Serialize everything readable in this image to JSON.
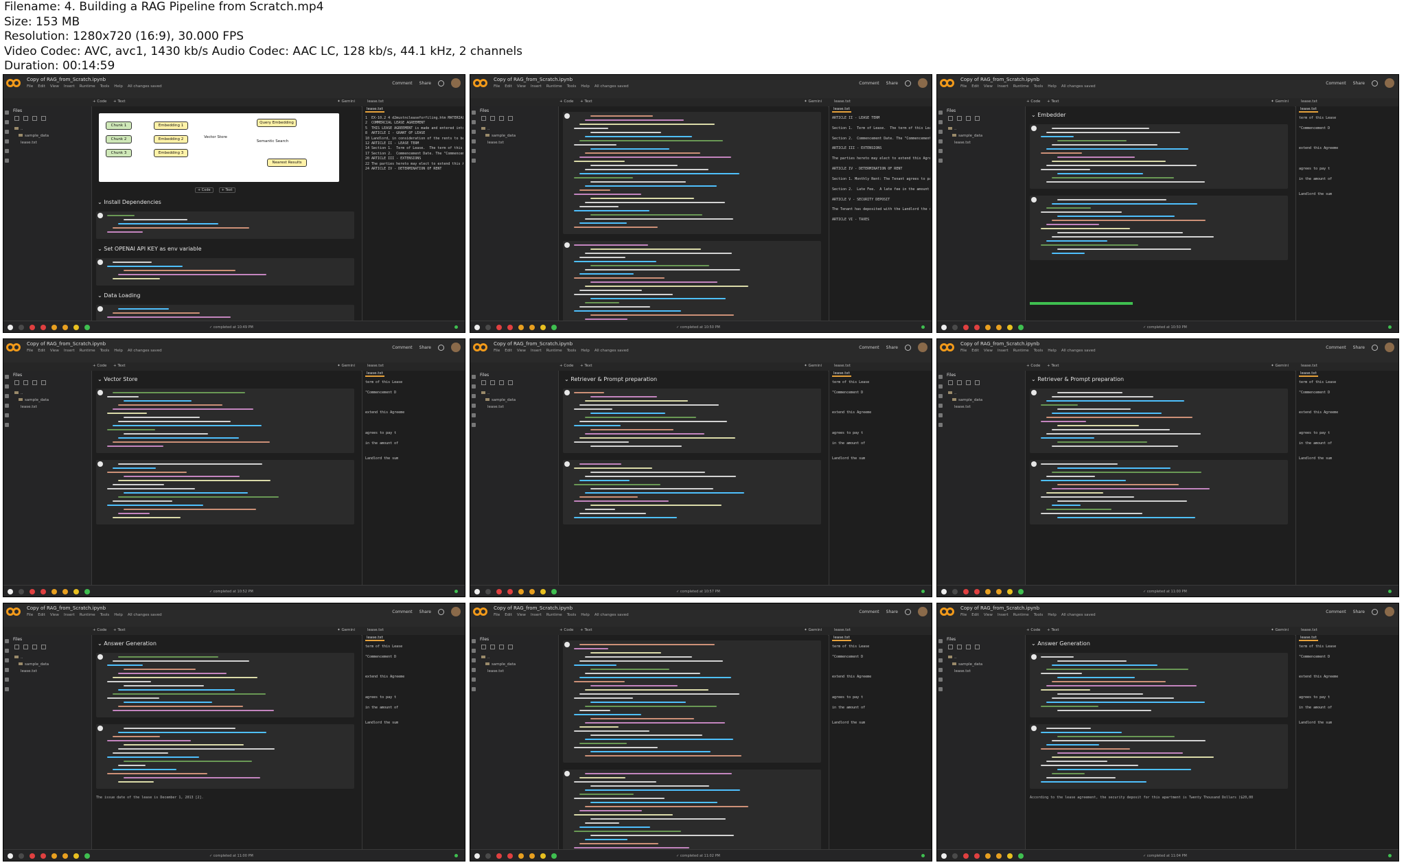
{
  "header": {
    "filename": "Filename: 4. Building a RAG Pipeline from Scratch.mp4",
    "size": "Size: 153 MB",
    "resolution": "Resolution: 1280x720 (16:9), 30.000 FPS",
    "codec": "Video Codec: AVC, avc1, 1430 kb/s Audio Codec: AAC LC, 128 kb/s, 44.1 kHz, 2 channels",
    "duration": "Duration: 00:14:59"
  },
  "colab": {
    "notebook_title": "Copy of RAG_from_Scratch.ipynb",
    "menu": [
      "File",
      "Edit",
      "View",
      "Insert",
      "Runtime",
      "Tools",
      "Help",
      "All changes saved"
    ],
    "top_right": [
      "Comment",
      "Share"
    ],
    "tool_row": [
      "+ Code",
      "+ Text"
    ],
    "files_header": "Files",
    "tree": [
      "..",
      "sample_data",
      "lease.txt"
    ],
    "editor_tab": "lease.txt",
    "gemini": "Gemini",
    "cell_buttons": [
      "+ Code",
      "+ Text"
    ]
  },
  "thumbs": [
    {
      "sections": [
        "Install Dependencies",
        "Set OPENAI API KEY as env variable",
        "Data Loading"
      ],
      "diagram": [
        "Chunk 1",
        "Chunk 2",
        "Chunk 3",
        "Embedding 1",
        "Embedding 2",
        "Embedding 3",
        "Vector Store",
        "Query Embedding",
        "Semantic Search",
        "Nearest Results"
      ],
      "status": "completed at 10:49 PM",
      "editor": [
        "1  EX-10.2 4 d2mustncleaseforfiling.htm MATERIAL CONTRACT",
        "2  COMMERCIAL LEASE AGREEMENT",
        "5  THIS LEASE AGREEMENT is made and entered into on December",
        "8  ARTICLE I - GRANT OF LEASE",
        "10 Landlord, in consideration of the rents to be paid and",
        "12 ARTICLE II - LEASE TERM",
        "14 Section 1.  Term of Lease.  The term of this Lease sha",
        "17 Section 2.  Commencement Date. The \"Commencement Date\"",
        "20 ARTICLE III - EXTENSIONS",
        "22 The parties hereto may elect to extend this Agreement",
        "24 ARTICLE IV - DETERMINATION OF RENT"
      ]
    },
    {
      "sections": [],
      "status": "completed at 10:50 PM",
      "editor": [
        "ARTICLE II - LEASE TERM",
        "",
        "Section 1.  Term of Lease.  The term of this Lease",
        "",
        "Section 2.  Commencement Date. The \"Commencement D",
        "",
        "ARTICLE III - EXTENSIONS",
        "",
        "The parties hereto may elect to extend this Agree",
        "",
        "ARTICLE IV - DETERMINATION OF RENT",
        "",
        "Section 1. Monthly Rent: The Tenant agrees to pay",
        "",
        "Section 2.  Late Fee.  A late fee in the amount of",
        "",
        "ARTICLE V - SECURITY DEPOSIT",
        "",
        "The Tenant has deposited with the Landlord the sum",
        "",
        "ARTICLE VI - TAXES"
      ]
    },
    {
      "sections": [
        "Embedder"
      ],
      "status": "completed at 10:50 PM",
      "editor": [
        "term of this Lease",
        "",
        "\"Commencement D",
        "",
        "",
        "",
        "extend this Agreeme",
        "",
        "",
        "",
        "agrees to pay t",
        "",
        "in the amount of",
        "",
        "",
        "Landlord the sum"
      ]
    },
    {
      "sections": [
        "Vector Store"
      ],
      "status": "completed at 10:52 PM",
      "editor": [
        "term of this Lease",
        "",
        "\"Commencement D",
        "",
        "",
        "",
        "extend this Agreeme",
        "",
        "",
        "",
        "agrees to pay t",
        "",
        "in the amount of",
        "",
        "",
        "Landlord the sum"
      ]
    },
    {
      "sections": [
        "Retriever & Prompt preparation"
      ],
      "status": "completed at 10:57 PM",
      "editor": [
        "term of this Lease",
        "",
        "\"Commencement D",
        "",
        "",
        "",
        "extend this Agreeme",
        "",
        "",
        "",
        "agrees to pay t",
        "",
        "in the amount of",
        "",
        "",
        "Landlord the sum"
      ]
    },
    {
      "sections": [
        "Retriever & Prompt preparation"
      ],
      "status": "completed at 11:00 PM",
      "editor": [
        "term of this Lease",
        "",
        "\"Commencement D",
        "",
        "",
        "",
        "extend this Agreeme",
        "",
        "",
        "",
        "agrees to pay t",
        "",
        "in the amount of",
        "",
        "",
        "Landlord the sum"
      ]
    },
    {
      "sections": [
        "Answer Generation"
      ],
      "status": "completed at 11:00 PM",
      "output": "The issue date of the lease is December 1, 2013 [2].",
      "editor": [
        "term of this Lease",
        "",
        "\"Commencement D",
        "",
        "",
        "",
        "extend this Agreeme",
        "",
        "",
        "",
        "agrees to pay t",
        "",
        "in the amount of",
        "",
        "",
        "Landlord the sum"
      ]
    },
    {
      "sections": [],
      "status": "completed at 11:02 PM",
      "editor": [
        "term of this Lease",
        "",
        "\"Commencement D",
        "",
        "",
        "",
        "extend this Agreeme",
        "",
        "",
        "",
        "agrees to pay t",
        "",
        "in the amount of",
        "",
        "",
        "Landlord the sum"
      ]
    },
    {
      "sections": [
        "Answer Generation"
      ],
      "status": "completed at 11:04 PM",
      "output": "According to the lease agreement, the security deposit for this apartment is Twenty Thousand Dollars ($20,00",
      "editor": [
        "term of this Lease",
        "",
        "\"Commencement D",
        "",
        "",
        "",
        "extend this Agreeme",
        "",
        "",
        "",
        "agrees to pay t",
        "",
        "in the amount of",
        "",
        "",
        "Landlord the sum"
      ]
    }
  ]
}
